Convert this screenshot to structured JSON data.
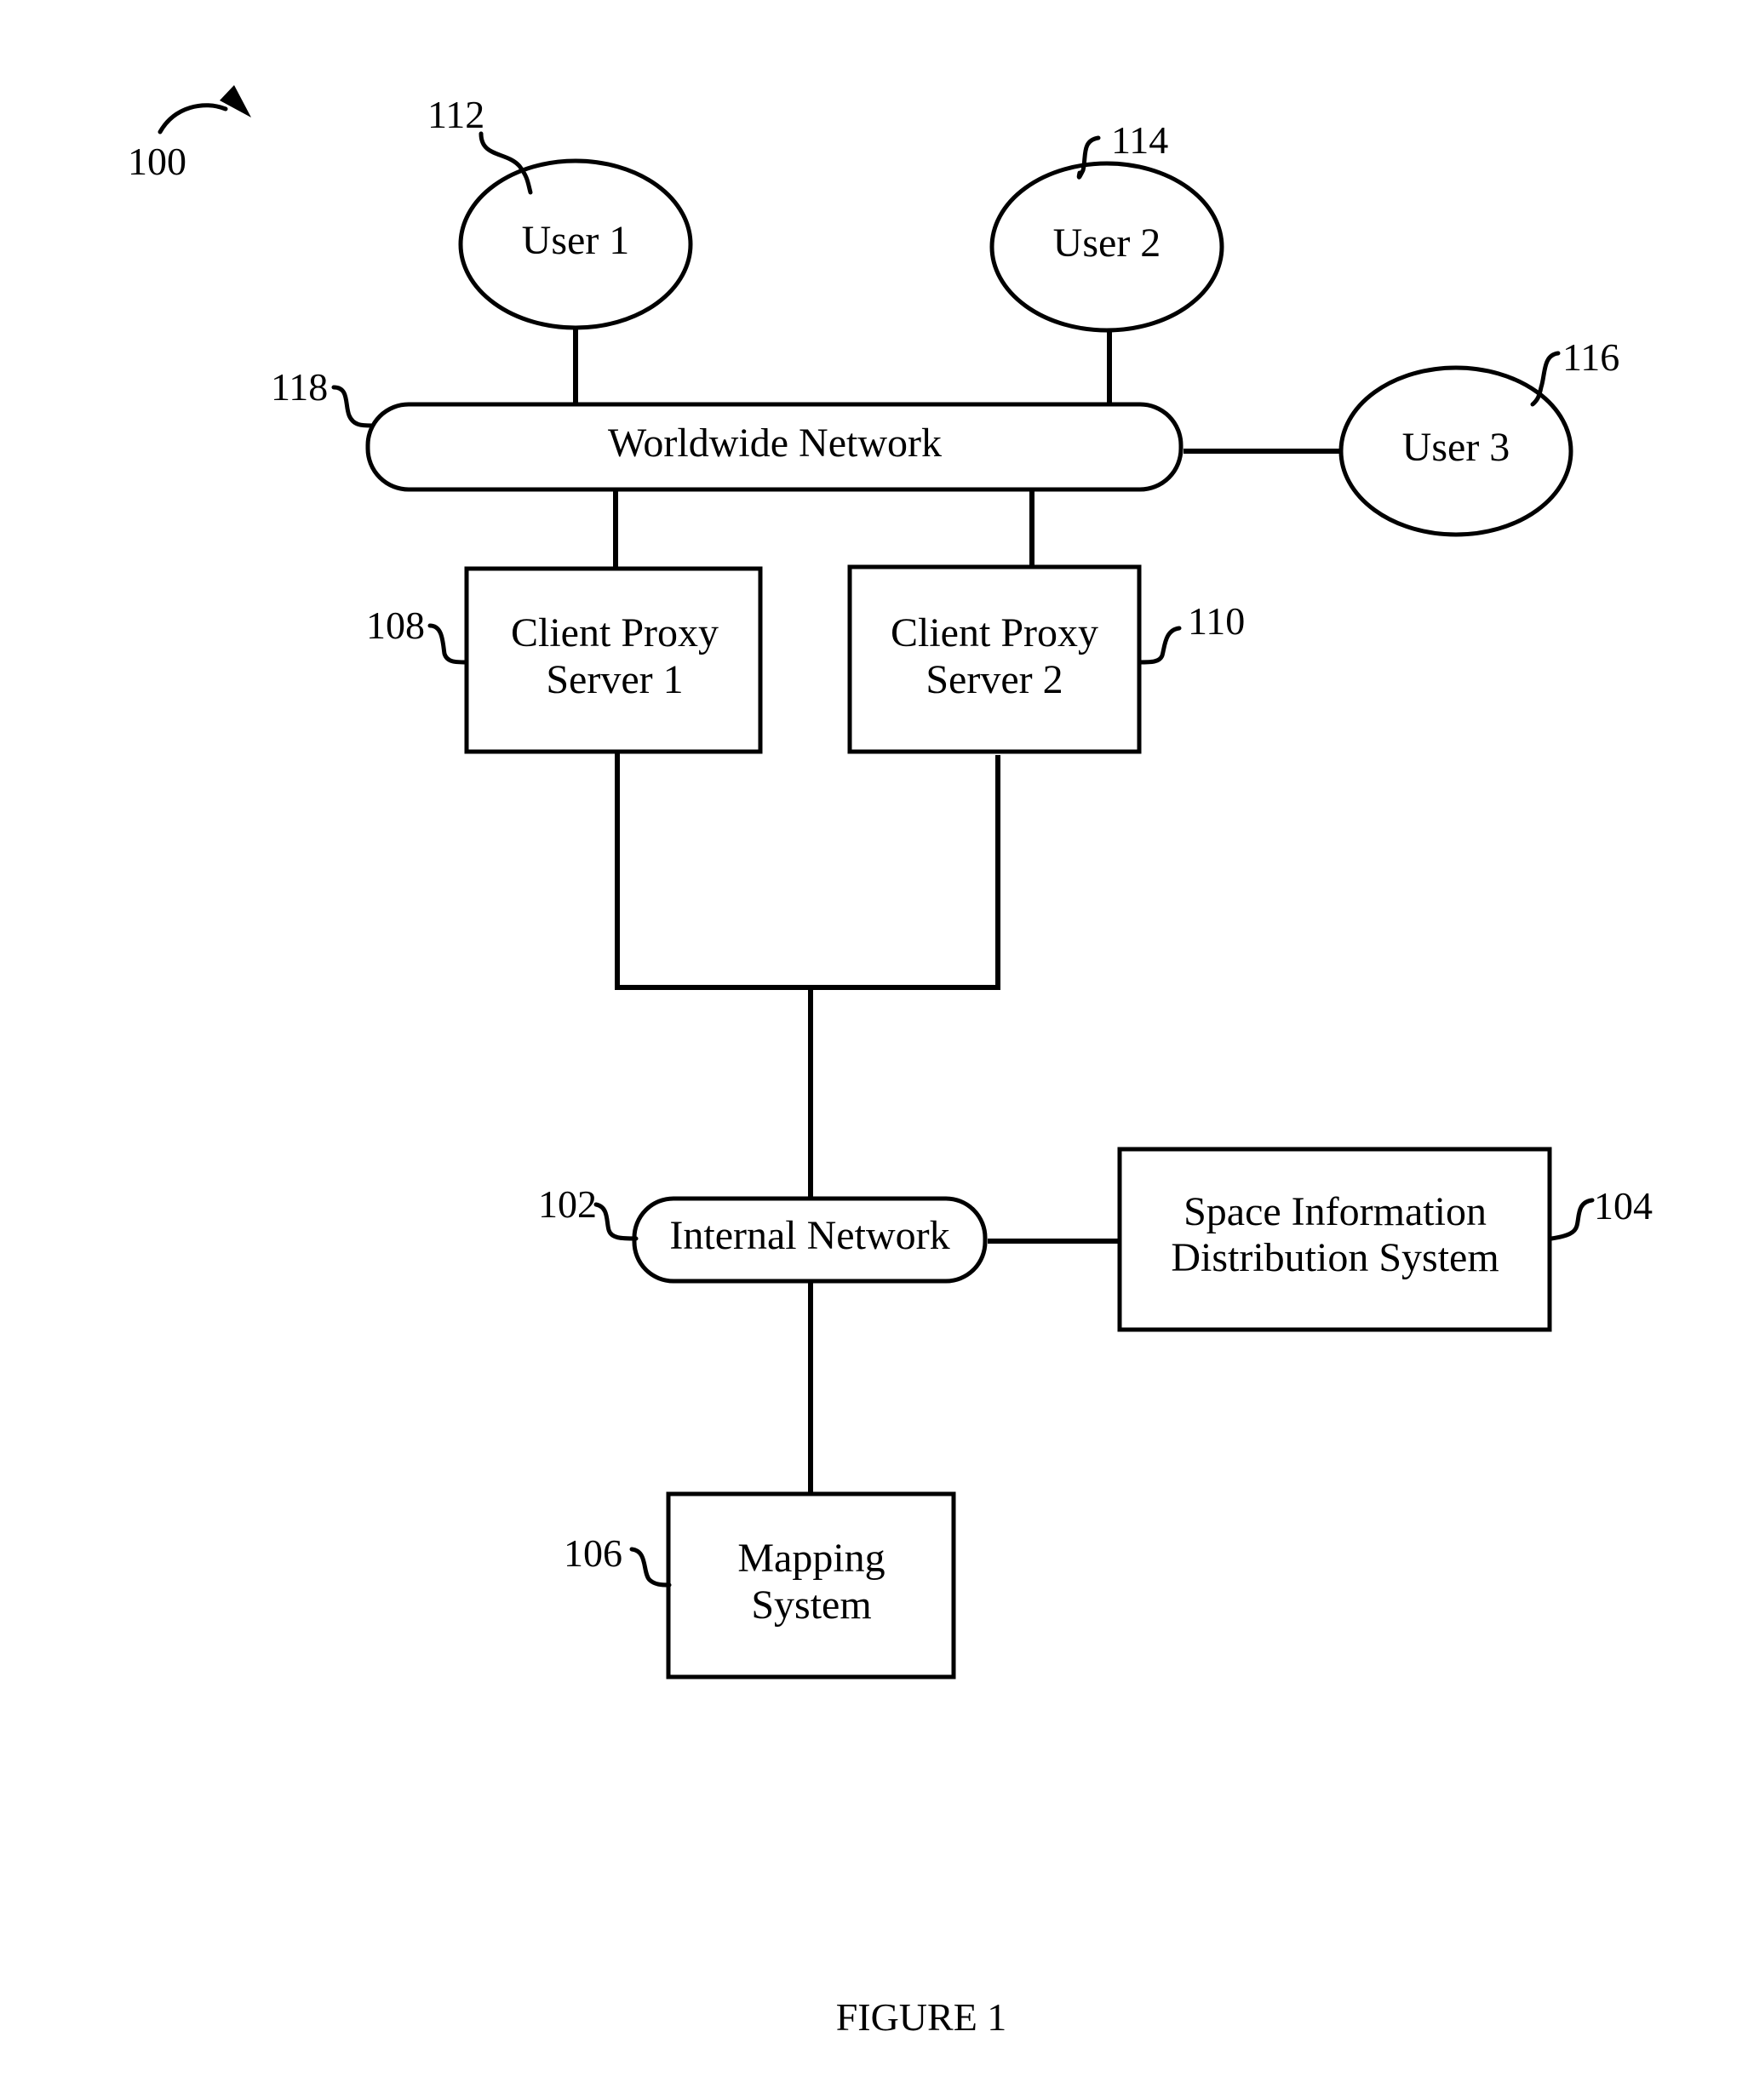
{
  "figure": {
    "ref": "100",
    "caption": "FIGURE 1"
  },
  "nodes": {
    "user1": {
      "ref": "112",
      "label": "User 1",
      "shape": "ellipse"
    },
    "user2": {
      "ref": "114",
      "label": "User 2",
      "shape": "ellipse"
    },
    "user3": {
      "ref": "116",
      "label": "User 3",
      "shape": "ellipse"
    },
    "worldwide_network": {
      "ref": "118",
      "label": "Worldwide Network",
      "shape": "rounded-rect"
    },
    "proxy1": {
      "ref": "108",
      "label_lines": [
        "Client Proxy",
        "Server 1"
      ],
      "shape": "rect"
    },
    "proxy2": {
      "ref": "110",
      "label_lines": [
        "Client Proxy",
        "Server 2"
      ],
      "shape": "rect"
    },
    "internal_network": {
      "ref": "102",
      "label": "Internal Network",
      "shape": "rounded-rect"
    },
    "space_info": {
      "ref": "104",
      "label_lines": [
        "Space Information",
        "Distribution System"
      ],
      "shape": "rect"
    },
    "mapping": {
      "ref": "106",
      "label_lines": [
        "Mapping",
        "System"
      ],
      "shape": "rect"
    }
  },
  "edges": [
    {
      "from": "user1",
      "to": "worldwide_network"
    },
    {
      "from": "user2",
      "to": "worldwide_network"
    },
    {
      "from": "user3",
      "to": "worldwide_network"
    },
    {
      "from": "worldwide_network",
      "to": "proxy1"
    },
    {
      "from": "worldwide_network",
      "to": "proxy2"
    },
    {
      "from": "proxy1",
      "to": "internal_network"
    },
    {
      "from": "proxy2",
      "to": "internal_network"
    },
    {
      "from": "internal_network",
      "to": "space_info"
    },
    {
      "from": "internal_network",
      "to": "mapping"
    }
  ]
}
